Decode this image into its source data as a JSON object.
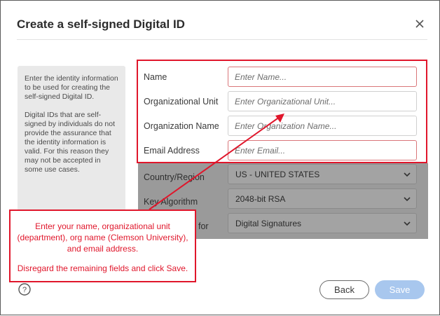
{
  "dialog": {
    "title": "Create a self-signed Digital ID",
    "close_icon": "close-icon"
  },
  "help": {
    "paragraph1": "Enter the identity information to be used for creating the self-signed Digital ID.",
    "paragraph2": "Digital IDs that are self-signed by individuals do not provide the assurance that the identity information is valid. For this reason they may not be accepted in some use cases."
  },
  "fields": {
    "name": {
      "label": "Name",
      "placeholder": "Enter Name..."
    },
    "org_unit": {
      "label": "Organizational Unit",
      "placeholder": "Enter Organizational Unit..."
    },
    "org_name": {
      "label": "Organization Name",
      "placeholder": "Enter Organization Name..."
    },
    "email": {
      "label": "Email Address",
      "placeholder": "Enter Email..."
    },
    "country": {
      "label": "Country/Region",
      "value": "US - UNITED STATES"
    },
    "key_algorithm": {
      "label": "Key Algorithm",
      "value": "2048-bit RSA"
    },
    "use_for": {
      "label_visible": "for",
      "value": "Digital Signatures"
    }
  },
  "callout": {
    "line1": "Enter your name, organizational unit (department), org name (Clemson University), and email address.",
    "line2": "Disregard the remaining fields and click Save."
  },
  "footer": {
    "help_icon": "question-icon",
    "back_label": "Back",
    "save_label": "Save"
  },
  "colors": {
    "annotation_red": "#e0162b",
    "save_button": "#a8c7ee",
    "overlay_grey": "#9a9a9a"
  }
}
